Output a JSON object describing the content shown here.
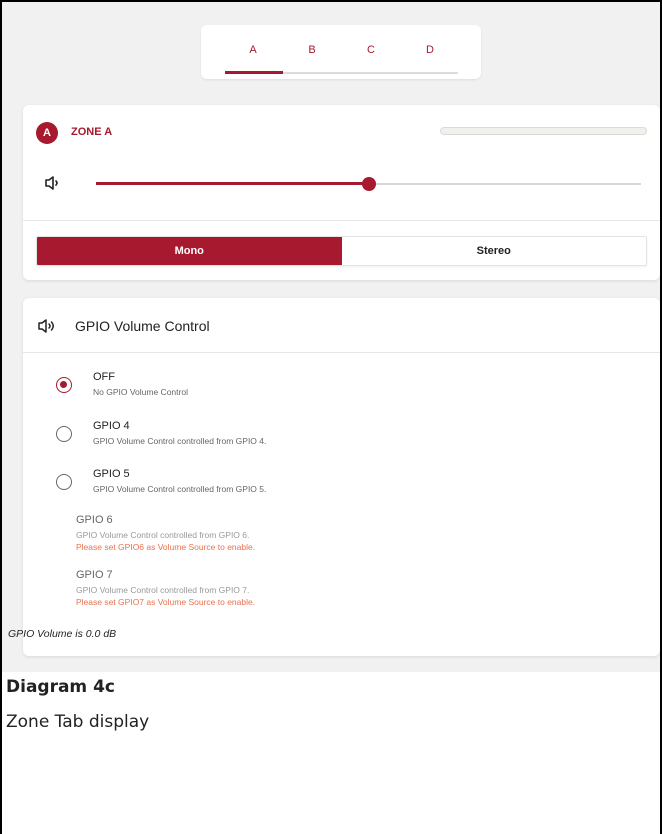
{
  "tabs": [
    {
      "label": "A",
      "active": true
    },
    {
      "label": "B",
      "active": false
    },
    {
      "label": "C",
      "active": false
    },
    {
      "label": "D",
      "active": false
    }
  ],
  "zone": {
    "badge": "A",
    "title": "ZONE A",
    "name_value": "",
    "volume_fraction": 0.5,
    "volume_icon": "speaker-low-icon",
    "modes": [
      {
        "label": "Mono",
        "selected": true
      },
      {
        "label": "Stereo",
        "selected": false
      }
    ]
  },
  "gpio": {
    "header_icon": "speaker-icon",
    "title": "GPIO Volume Control",
    "options": [
      {
        "label": "OFF",
        "description": "No GPIO Volume Control",
        "checked": true
      },
      {
        "label": "GPIO 4",
        "description": "GPIO Volume Control controlled from GPIO 4.",
        "checked": false
      },
      {
        "label": "GPIO 5",
        "description": "GPIO Volume Control controlled from GPIO 5.",
        "checked": false
      }
    ],
    "disabled_options": [
      {
        "label": "GPIO 6",
        "description": "GPIO Volume Control controlled from GPIO 6.",
        "warning": "Please set GPIO6 as Volume Source to enable."
      },
      {
        "label": "GPIO 7",
        "description": "GPIO Volume Control controlled from GPIO 7.",
        "warning": "Please set GPIO7 as Volume Source to enable."
      }
    ],
    "status": "GPIO Volume is 0.0 dB"
  },
  "caption": {
    "title": "Diagram 4c",
    "subtitle": "Zone Tab display"
  },
  "colors": {
    "accent": "#a6192e",
    "warning": "#e8724f"
  }
}
